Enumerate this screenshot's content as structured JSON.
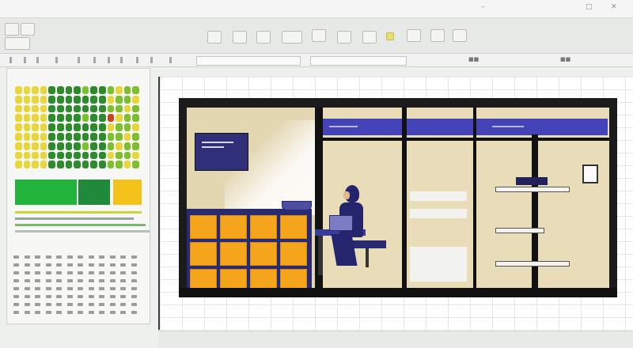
{
  "window": {
    "title_left": "",
    "menu_short": "",
    "controls": [
      "–",
      "□",
      "✕"
    ]
  },
  "ribbon": {
    "icons": [
      "clipboard-icon",
      "format-icon",
      "table-icon",
      "image-icon",
      "chart-icon",
      "folder-icon",
      "cloud-icon",
      "bulb-icon",
      "print-icon",
      "user-icon"
    ]
  },
  "formula_bar": {
    "cell_ref": "",
    "value": ""
  },
  "left_panel": {
    "header_text": "",
    "numeric_rows": 8
  },
  "accent_colors": {
    "green": "#22b43a",
    "dark_green": "#1f8a3a",
    "yellow": "#f5c21b",
    "navy": "#2a2a70",
    "indigo": "#4444b8",
    "orange": "#f5a51c"
  }
}
